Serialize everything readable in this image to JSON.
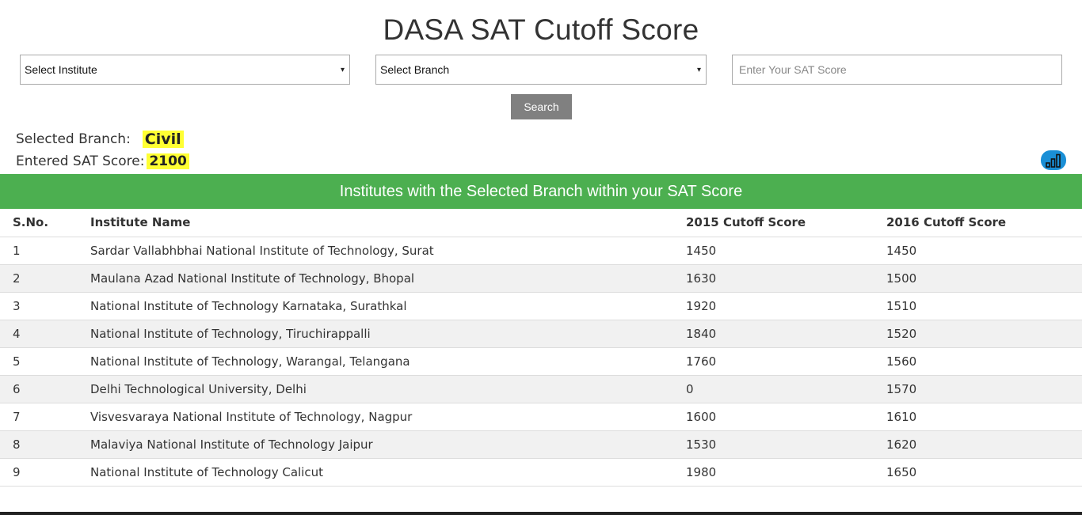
{
  "page": {
    "title": "DASA SAT Cutoff Score"
  },
  "filters": {
    "institute_select": "Select Institute",
    "branch_select": "Select Branch",
    "score_placeholder": "Enter Your SAT Score",
    "search_label": "Search"
  },
  "selection": {
    "branch_label": "Selected Branch:",
    "branch_value": "Civil",
    "score_label": "Entered SAT Score:",
    "score_value": "2100"
  },
  "icons": {
    "chart_button": "bar-chart-icon",
    "dropdown_arrow": "▾"
  },
  "banner": {
    "text": "Institutes with the Selected Branch within your SAT Score"
  },
  "table": {
    "headers": [
      "S.No.",
      "Institute Name",
      "2015 Cutoff Score",
      "2016 Cutoff Score"
    ],
    "rows": [
      [
        "1",
        "Sardar Vallabhbhai National Institute of Technology, Surat",
        "1450",
        "1450"
      ],
      [
        "2",
        "Maulana Azad National Institute of Technology, Bhopal",
        "1630",
        "1500"
      ],
      [
        "3",
        "National Institute of Technology Karnataka, Surathkal",
        "1920",
        "1510"
      ],
      [
        "4",
        "National Institute of Technology, Tiruchirappalli",
        "1840",
        "1520"
      ],
      [
        "5",
        "National Institute of Technology, Warangal, Telangana",
        "1760",
        "1560"
      ],
      [
        "6",
        "Delhi Technological University, Delhi",
        "0",
        "1570"
      ],
      [
        "7",
        "Visvesvaraya National Institute of Technology, Nagpur",
        "1600",
        "1610"
      ],
      [
        "8",
        "Malaviya National Institute of Technology Jaipur",
        "1530",
        "1620"
      ],
      [
        "9",
        "National Institute of Technology Calicut",
        "1980",
        "1650"
      ]
    ]
  },
  "colors": {
    "banner_bg": "#4caf50",
    "highlight": "#ffff33",
    "search_button_bg": "#808080",
    "chart_button_bg": "#1a8fd6",
    "row_stripe": "#f1f1f1"
  }
}
